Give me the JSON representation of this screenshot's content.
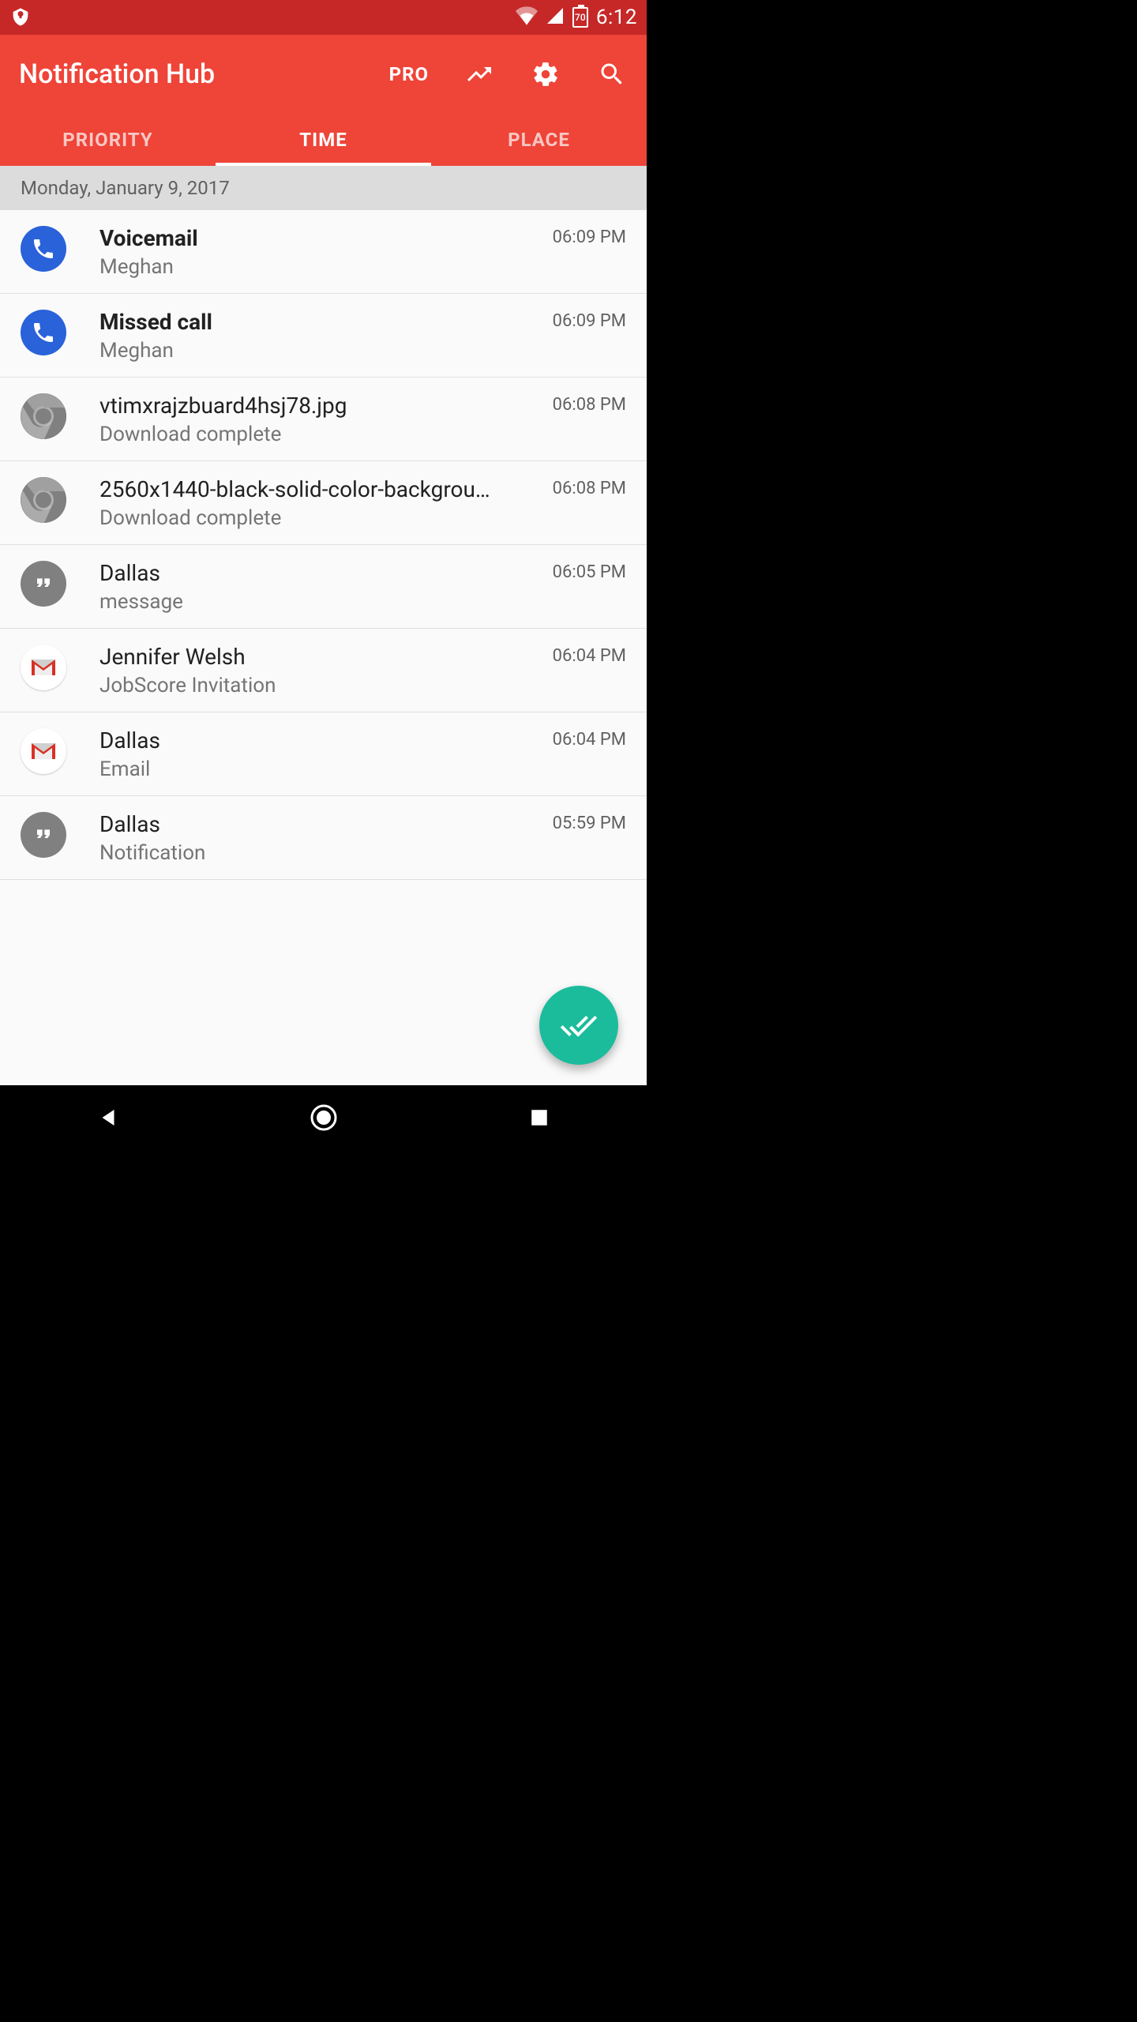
{
  "status": {
    "time": "6:12",
    "battery": "70"
  },
  "header": {
    "title": "Notification Hub",
    "pro": "PRO"
  },
  "tabs": [
    {
      "label": "PRIORITY",
      "active": false
    },
    {
      "label": "TIME",
      "active": true
    },
    {
      "label": "PLACE",
      "active": false
    }
  ],
  "date_header": "Monday, January 9, 2017",
  "notifications": [
    {
      "icon": "phone",
      "title": "Voicemail",
      "subtitle": "Meghan",
      "time": "06:09 PM",
      "bold": true
    },
    {
      "icon": "phone",
      "title": "Missed call",
      "subtitle": "Meghan",
      "time": "06:09 PM",
      "bold": true
    },
    {
      "icon": "chrome",
      "title": "vtimxrajzbuard4hsj78.jpg",
      "subtitle": "Download complete",
      "time": "06:08 PM",
      "bold": false
    },
    {
      "icon": "chrome",
      "title": "2560x1440-black-solid-color-backgrou…",
      "subtitle": "Download complete",
      "time": "06:08 PM",
      "bold": false
    },
    {
      "icon": "hangouts",
      "title": "Dallas",
      "subtitle": "message",
      "time": "06:05 PM",
      "bold": false
    },
    {
      "icon": "gmail",
      "title": "Jennifer Welsh",
      "subtitle": "JobScore Invitation",
      "time": "06:04 PM",
      "bold": false
    },
    {
      "icon": "gmail",
      "title": "Dallas",
      "subtitle": "Email",
      "time": "06:04 PM",
      "bold": false
    },
    {
      "icon": "hangouts",
      "title": "Dallas",
      "subtitle": "Notification",
      "time": "05:59 PM",
      "bold": false
    }
  ]
}
